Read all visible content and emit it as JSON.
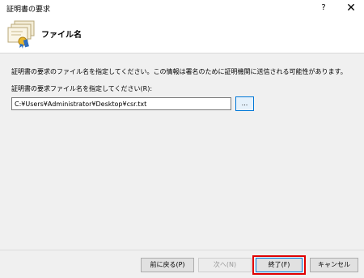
{
  "window": {
    "title": "証明書の要求",
    "help_label": "?",
    "close_label": "✕"
  },
  "header": {
    "title": "ファイル名",
    "icon": "certificate-stack-icon"
  },
  "content": {
    "description": "証明書の要求のファイル名を指定してください。この情報は署名のために証明機関に送信される可能性があります。",
    "field_label": "証明書の要求ファイル名を指定してください(R):",
    "file_path": "C:¥Users¥Administrator¥Desktop¥csr.txt",
    "browse_label": "..."
  },
  "footer": {
    "back_label": "前に戻る(P)",
    "next_label": "次へ(N)",
    "finish_label": "終了(F)",
    "cancel_label": "キャンセル"
  },
  "colors": {
    "accent": "#0078d7",
    "highlight": "#e00000",
    "panel_bg": "#f0f0f0"
  }
}
